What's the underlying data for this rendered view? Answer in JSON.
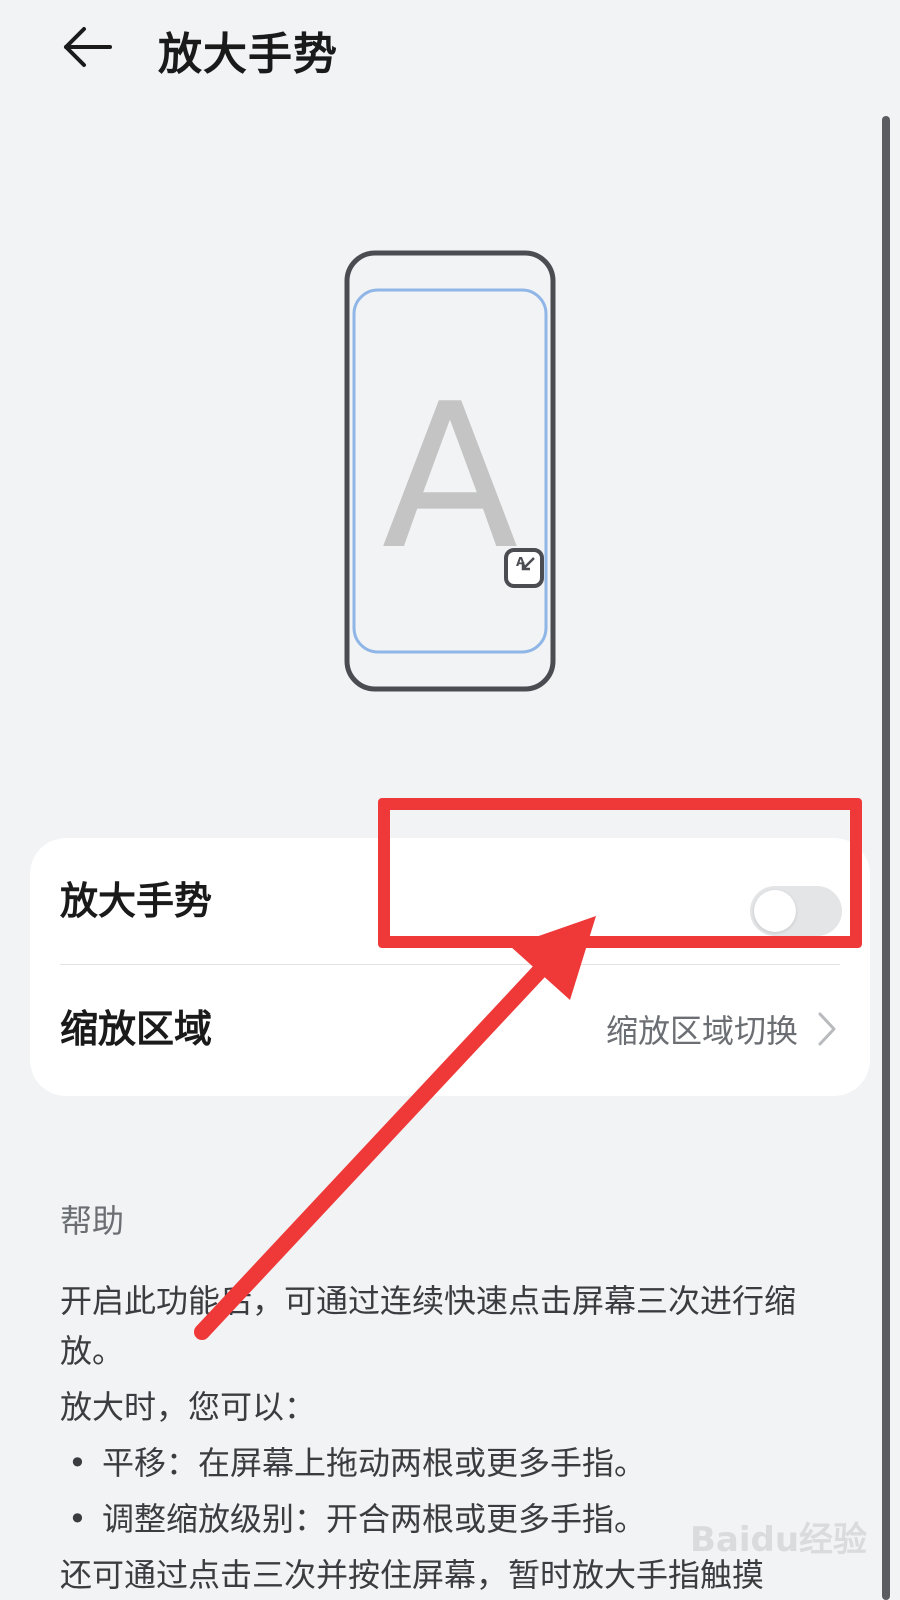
{
  "header": {
    "title": "放大手势",
    "back_icon": "arrow-left-icon"
  },
  "illustration": {
    "letter": "A",
    "frame_color": "#4a4c52",
    "inner_color": "#8fb6e6",
    "letter_color": "#c4c4c4"
  },
  "settings": {
    "magnify_gesture": {
      "label": "放大手势",
      "enabled": false
    },
    "zoom_area": {
      "label": "缩放区域",
      "value": "缩放区域切换"
    }
  },
  "help": {
    "heading": "帮助",
    "paragraph_1": "开启此功能后，可通过连续快速点击屏幕三次进行缩放。",
    "paragraph_2": "放大时，您可以：",
    "bullets": [
      "平移：在屏幕上拖动两根或更多手指。",
      "调整缩放级别：开合两根或更多手指。"
    ],
    "paragraph_3": "还可通过点击三次并按住屏幕，暂时放大手指触摸"
  },
  "overlay": {
    "color": "#ef3838"
  },
  "watermark": {
    "text": "Baidu经验"
  }
}
